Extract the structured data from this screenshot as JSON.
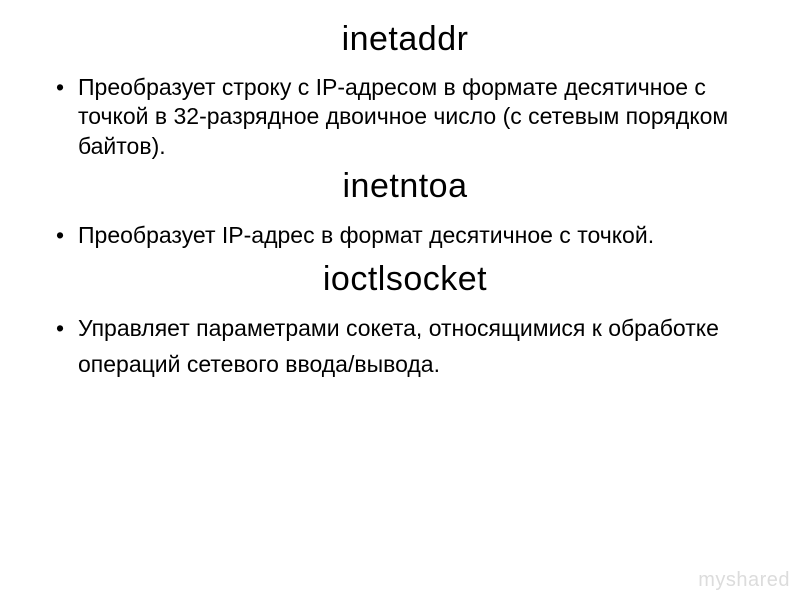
{
  "sections": [
    {
      "title": "inetaddr",
      "bullet": "Преобразует строку с IP-адресом в формате десятичное с точкой в 32-разрядное двоичное число (с сетевым порядком байтов)."
    },
    {
      "title": "inetntoa",
      "bullet": "Преобразует IP-адрес в формат десятичное с точкой."
    },
    {
      "title": "ioctlsocket",
      "bullet": "Управляет параметрами сокета, относящимися к обработке операций сетевого ввода/вывода."
    }
  ],
  "watermark": "myshared"
}
